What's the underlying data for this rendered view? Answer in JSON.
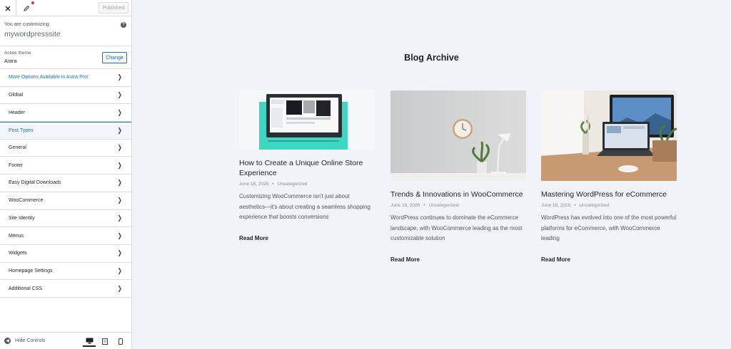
{
  "topbar": {
    "publish_label": "Published"
  },
  "customizing": {
    "label": "You are customizing",
    "site": "mywordpresssite"
  },
  "theme": {
    "label": "Active theme",
    "name": "Astra",
    "change_label": "Change"
  },
  "menu": [
    {
      "label": "More Options Available in Astra Pro!",
      "state": "highlight"
    },
    {
      "label": "Global",
      "state": ""
    },
    {
      "label": "Header",
      "state": ""
    },
    {
      "label": "Post Types",
      "state": "active"
    },
    {
      "label": "General",
      "state": ""
    },
    {
      "label": "Footer",
      "state": ""
    },
    {
      "label": "Easy Digital Downloads",
      "state": ""
    },
    {
      "label": "WooCommerce",
      "state": ""
    },
    {
      "label": "Site Identity",
      "state": ""
    },
    {
      "label": "Menus",
      "state": ""
    },
    {
      "label": "Widgets",
      "state": ""
    },
    {
      "label": "Homepage Settings",
      "state": ""
    },
    {
      "label": "Additional CSS",
      "state": ""
    }
  ],
  "bottombar": {
    "hide_label": "Hide Controls"
  },
  "archive": {
    "title": "Blog Archive",
    "posts": [
      {
        "title": "How to Create a Unique Online Store Experience",
        "date": "June 18, 2025",
        "category": "Uncategorized",
        "excerpt": "Customizing WooCommerce isn't just about aesthetics—it's about creating a seamless shopping experience that boosts conversions",
        "read_more": "Read More"
      },
      {
        "title": "Trends & Innovations in WooCommerce",
        "date": "June 18, 2025",
        "category": "Uncategorized",
        "excerpt": "WordPress continues to dominate the eCommerce landscape, with WooCommerce leading as the most customizable solution",
        "read_more": "Read More"
      },
      {
        "title": "Mastering WordPress for eCommerce",
        "date": "June 18, 2025",
        "category": "Uncategorized",
        "excerpt": "WordPress has evolved into one of the most powerful platforms for eCommerce, with WooCommerce leading",
        "read_more": "Read More"
      }
    ]
  },
  "colors": {
    "accent": "#2271b1",
    "background": "#f0f3f7",
    "teal": "#3fd7c3"
  },
  "icons": {
    "close": "close-icon",
    "edit": "pencil-icon",
    "help": "help-icon",
    "hide": "hide-controls-icon",
    "desktop": "desktop-icon",
    "tablet": "tablet-icon",
    "mobile": "mobile-icon"
  }
}
